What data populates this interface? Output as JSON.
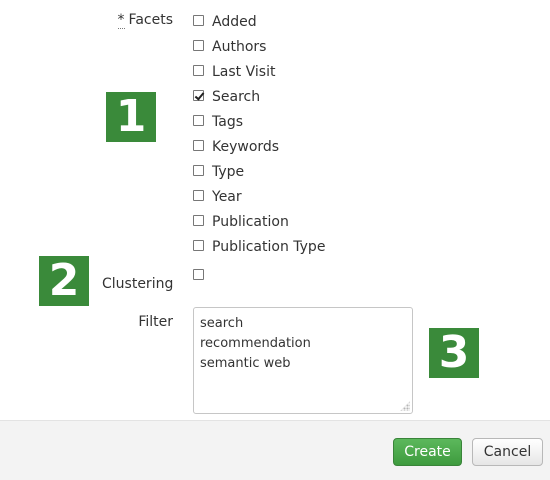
{
  "form": {
    "facets_required_marker": "*",
    "facets_label": "Facets",
    "facets": [
      {
        "label": "Added",
        "checked": false
      },
      {
        "label": "Authors",
        "checked": false
      },
      {
        "label": "Last Visit",
        "checked": false
      },
      {
        "label": "Search",
        "checked": true
      },
      {
        "label": "Tags",
        "checked": false
      },
      {
        "label": "Keywords",
        "checked": false
      },
      {
        "label": "Type",
        "checked": false
      },
      {
        "label": "Year",
        "checked": false
      },
      {
        "label": "Publication",
        "checked": false
      },
      {
        "label": "Publication Type",
        "checked": false
      }
    ],
    "clustering_label": "Clustering",
    "clustering_checked": false,
    "filter_label": "Filter",
    "filter_lines": [
      "search",
      "recommendation",
      "semantic web"
    ]
  },
  "badges": {
    "one": "1",
    "two": "2",
    "three": "3",
    "color": "#3a8a3a"
  },
  "footer": {
    "create_label": "Create",
    "cancel_label": "Cancel",
    "create_color": "#4cae4c"
  }
}
